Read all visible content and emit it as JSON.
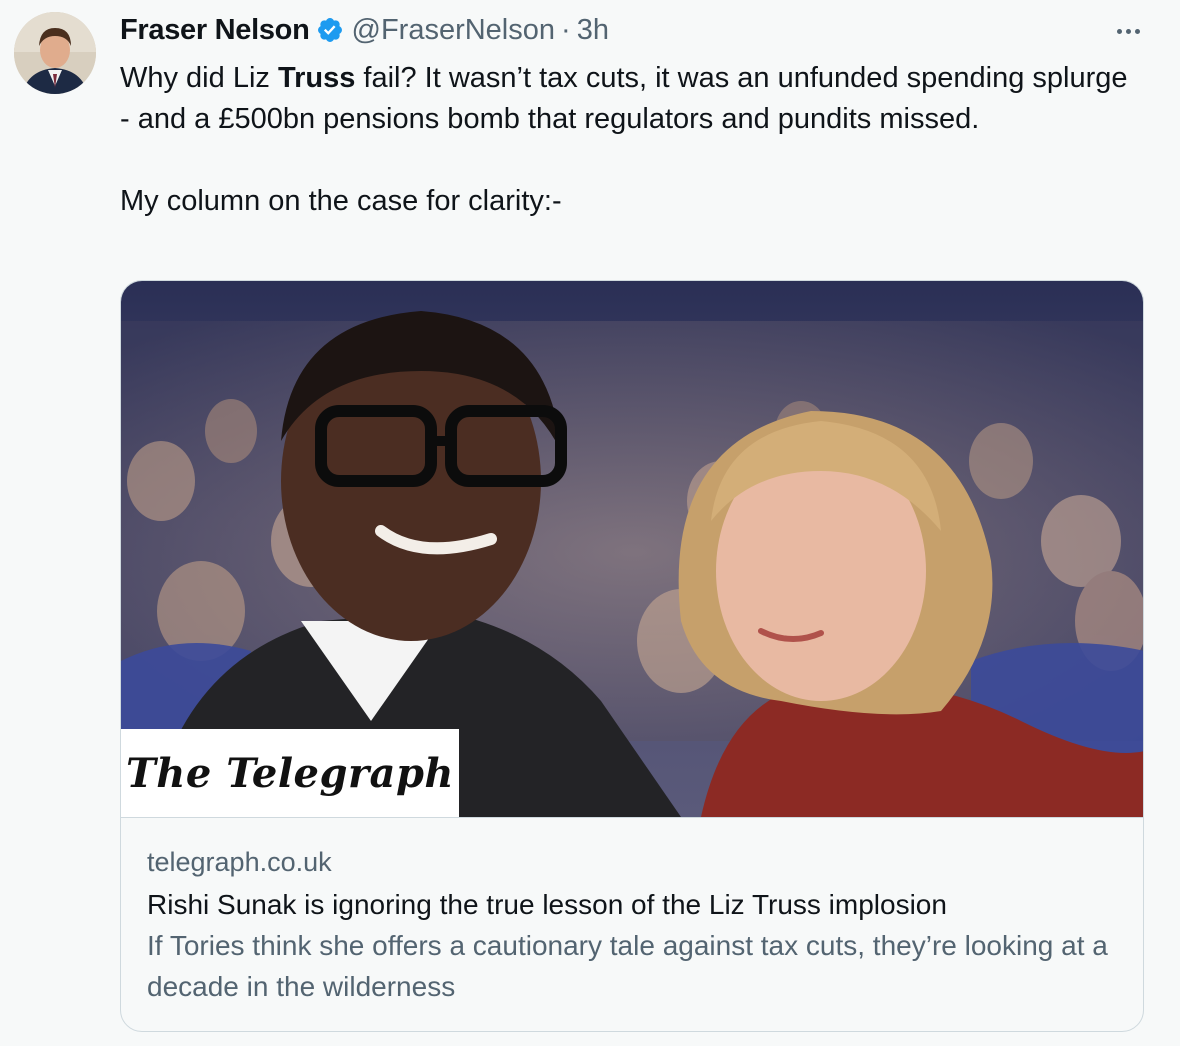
{
  "tweet": {
    "author_name": "Fraser Nelson",
    "author_handle": "@FraserNelson",
    "separator": "·",
    "time": "3h",
    "text_line1_a": "Why did Liz ",
    "text_line1_bold": "Truss",
    "text_line1_b": " fail? It wasn’t tax cuts, it was an unfunded spending splurge - and a £500bn pensions bomb that regulators and pundits missed.",
    "text_line2": "My column on the case for clarity:-"
  },
  "icons": {
    "verified": "verified-badge-icon",
    "more": "more-options-icon"
  },
  "card": {
    "logo_text": "The Telegraph",
    "domain": "telegraph.co.uk",
    "title": "Rishi Sunak is ignoring the true lesson of the Liz Truss implosion",
    "description": "If Tories think she offers a cautionary tale against tax cuts, they’re looking at a decade in the wilderness"
  },
  "colors": {
    "verified": "#1d9bf0",
    "secondary_text": "#536471",
    "border": "#cfd9de",
    "background": "#f7f9f9"
  }
}
